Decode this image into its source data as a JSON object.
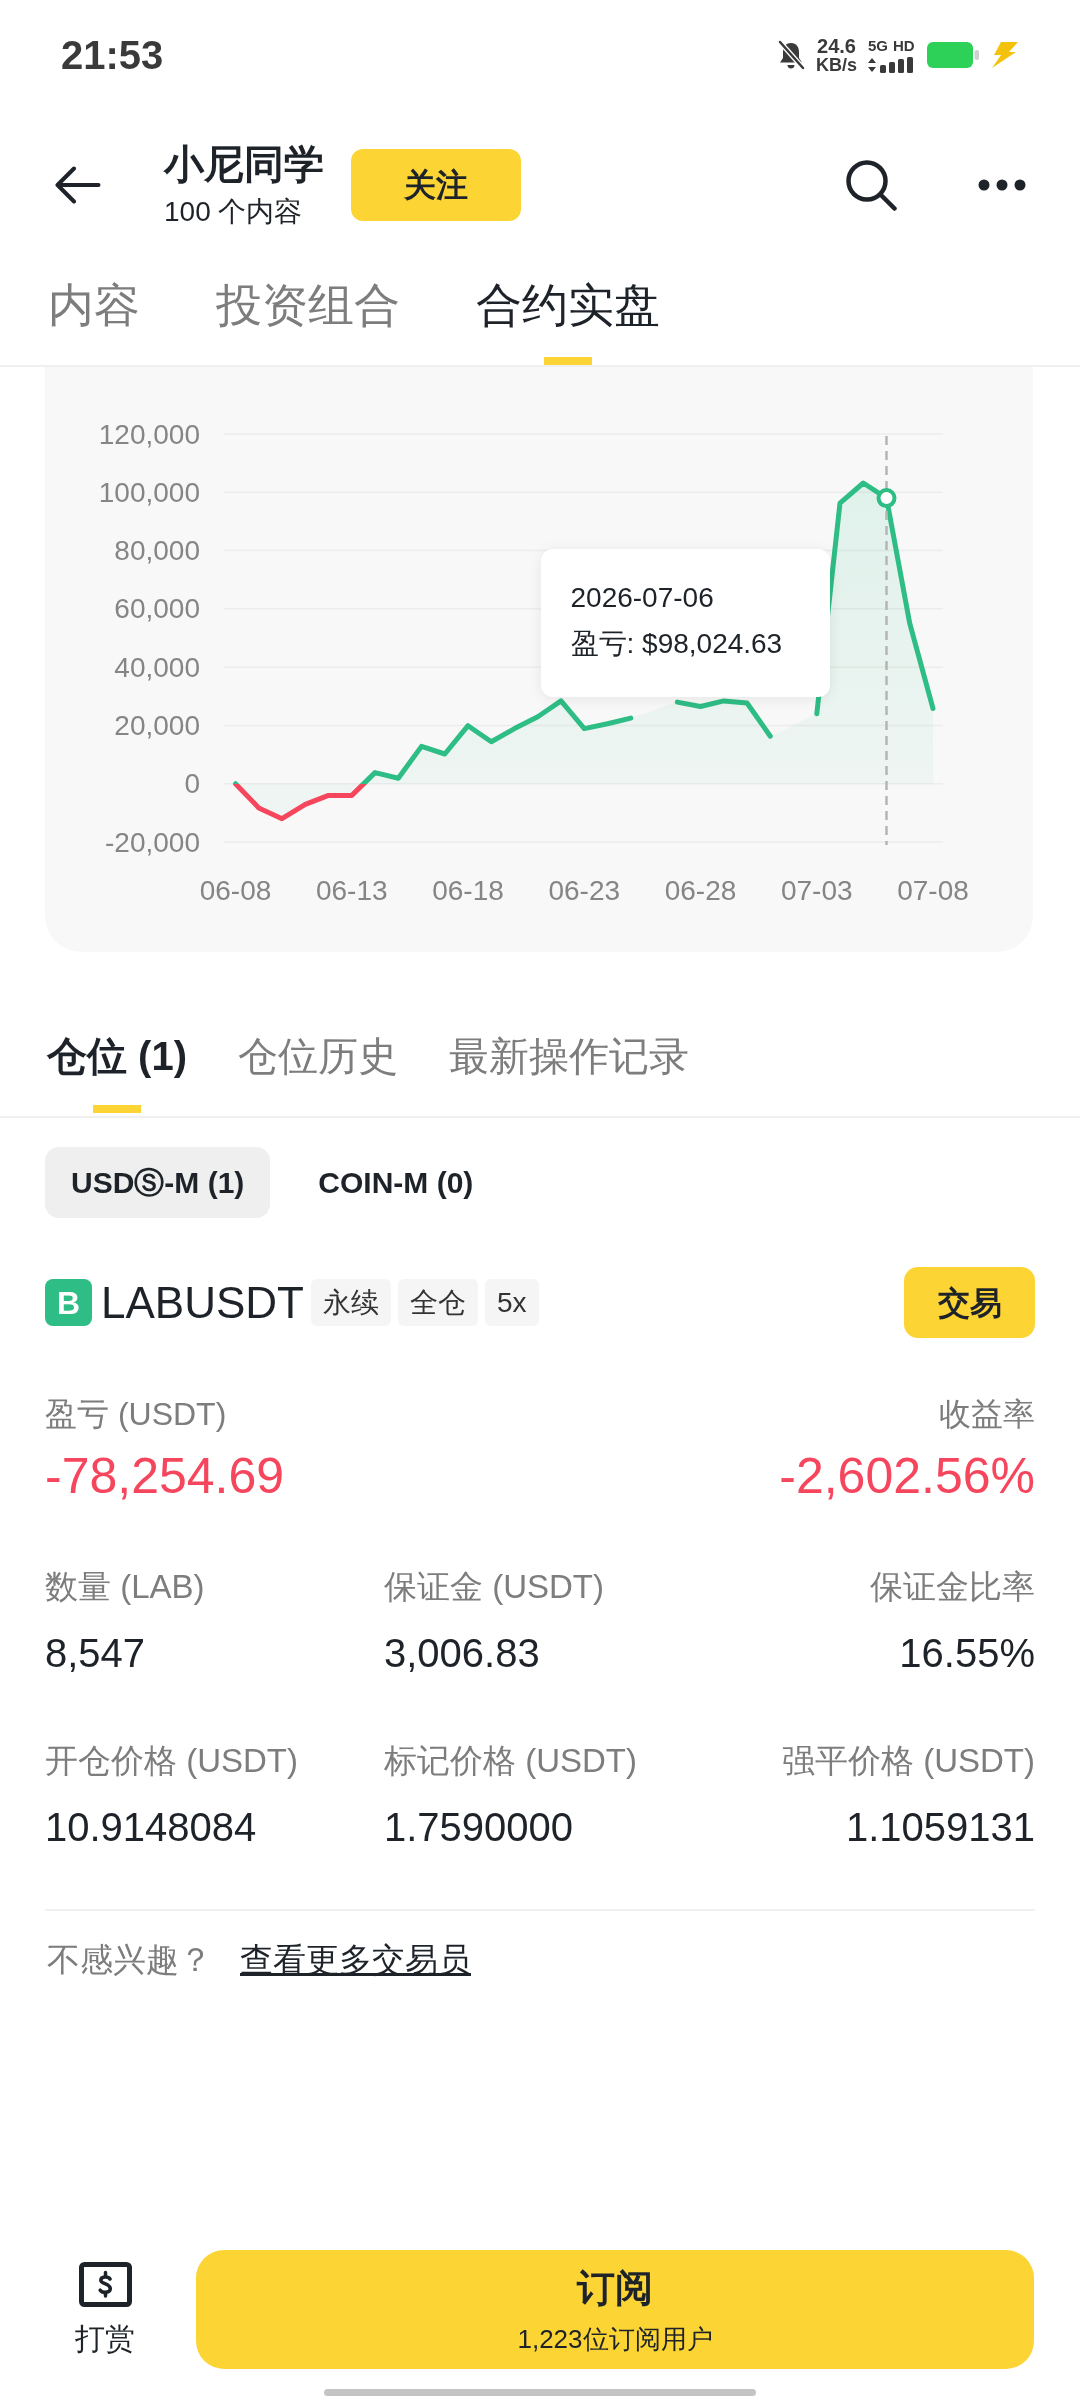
{
  "status_bar": {
    "time": "21:53",
    "speed": "24.6",
    "speed_unit": "KB/s",
    "network": "5G",
    "hd": "HD"
  },
  "header": {
    "title": "小尼同学",
    "subtitle": "100 个内容",
    "follow_button": "关注"
  },
  "tabs": [
    {
      "label": "内容",
      "selected": false
    },
    {
      "label": "投资组合",
      "selected": false
    },
    {
      "label": "合约实盘",
      "selected": true
    }
  ],
  "pnl_chart": {
    "chart_data": {
      "type": "area",
      "grid": true,
      "categories": [
        "06-08",
        null,
        null,
        null,
        null,
        "06-13",
        null,
        null,
        null,
        null,
        "06-18",
        null,
        null,
        null,
        null,
        "06-23",
        null,
        null,
        null,
        null,
        "06-28",
        null,
        null,
        null,
        null,
        "07-03",
        null,
        null,
        null,
        null,
        "07-08"
      ],
      "ylim": [
        -20000,
        120000
      ],
      "yticks": [
        {
          "value": -20000,
          "label": "-20,000"
        },
        {
          "value": 0,
          "label": "0"
        },
        {
          "value": 20000,
          "label": "20,000"
        },
        {
          "value": 40000,
          "label": "40,000"
        },
        {
          "value": 60000,
          "label": "60,000"
        },
        {
          "value": 80000,
          "label": "80,000"
        },
        {
          "value": 100000,
          "label": "100,000"
        },
        {
          "value": 120000,
          "label": "120,000"
        }
      ],
      "series": [
        {
          "color": "#2ebd85",
          "values": [
            0,
            -8300,
            -12000,
            -7100,
            -4000,
            -4000,
            3800,
            1900,
            12800,
            10200,
            19900,
            14400,
            18900,
            23000,
            28400,
            18900,
            20600,
            22500,
            null,
            28000,
            26500,
            28400,
            27700,
            16300,
            null,
            24000,
            96300,
            103200,
            98000,
            54900,
            25800
          ]
        }
      ],
      "annotations": [
        "2026-07-06",
        "盈亏: $98,024.63"
      ]
    }
  },
  "position_tabs": [
    {
      "label": "仓位 (1)",
      "selected": true
    },
    {
      "label": "仓位历史",
      "selected": false
    },
    {
      "label": "最新操作记录",
      "selected": false
    }
  ],
  "margin_tabs": [
    {
      "label": "USDⓈ-M (1)",
      "selected": true
    },
    {
      "label": "COIN-M (0)",
      "selected": false
    }
  ],
  "position": {
    "badge": "B",
    "symbol": "LABUSDT",
    "tags": [
      "永续",
      "全仓",
      "5x"
    ],
    "trade_button": "交易"
  },
  "summary": [
    {
      "label": "盈亏 (USDT)",
      "value": "-78,254.69",
      "kind": "loss"
    },
    {
      "label": "收益率",
      "value": "-2,602.56%",
      "kind": "loss"
    }
  ],
  "details": [
    {
      "label": "数量 (LAB)",
      "value": "8,547"
    },
    {
      "label": "保证金 (USDT)",
      "value": "3,006.83"
    },
    {
      "label": "保证金比率",
      "value": "16.55%"
    },
    {
      "label": "开仓价格 (USDT)",
      "value": "10.9148084"
    },
    {
      "label": "标记价格 (USDT)",
      "value": "1.7590000"
    },
    {
      "label": "强平价格 (USDT)",
      "value": "1.1059131"
    }
  ],
  "footer": {
    "prompt": "不感兴趣？",
    "link": "查看更多交易员"
  },
  "bottom_bar": {
    "tip_button": "打赏",
    "subscribe_button": "订阅",
    "subscriber_count": "1,223位订阅用户"
  }
}
